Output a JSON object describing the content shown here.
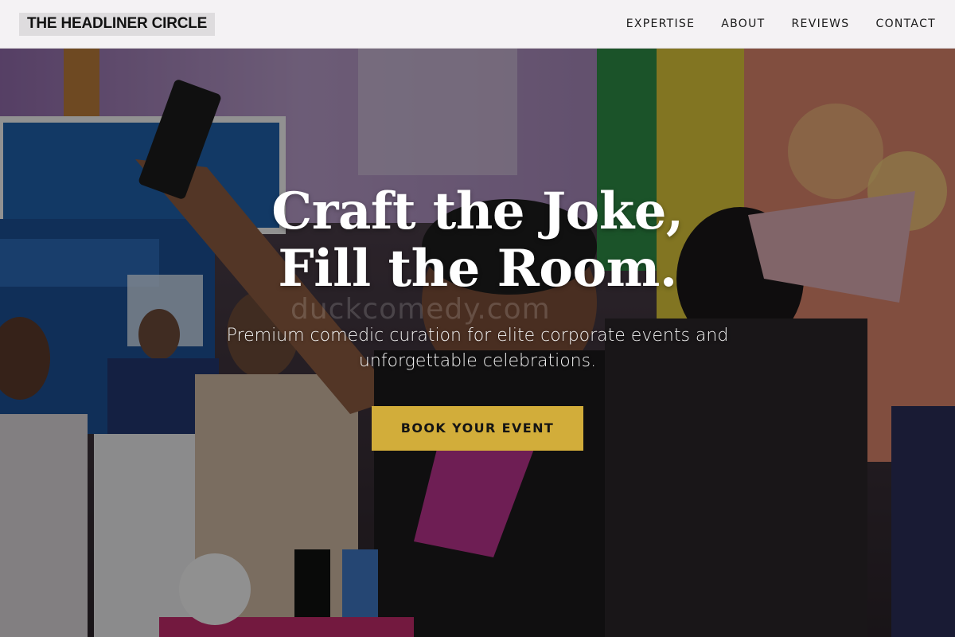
{
  "header": {
    "brand": "THE HEADLINER CIRCLE",
    "nav": [
      {
        "label": "EXPERTISE"
      },
      {
        "label": "ABOUT"
      },
      {
        "label": "REVIEWS"
      },
      {
        "label": "CONTACT"
      }
    ]
  },
  "hero": {
    "title_line1": "Craft the Joke,",
    "title_line2": "Fill the Room.",
    "subtitle": "Premium comedic curation for elite corporate events and unforgettable celebrations.",
    "cta_label": "BOOK YOUR EVENT",
    "watermark": "duckcomedy.com"
  },
  "colors": {
    "header_bg": "#f4f2f4",
    "brand_bg": "#dedcde",
    "cta_bg": "#d2ad3a",
    "hero_text": "#ffffff"
  }
}
